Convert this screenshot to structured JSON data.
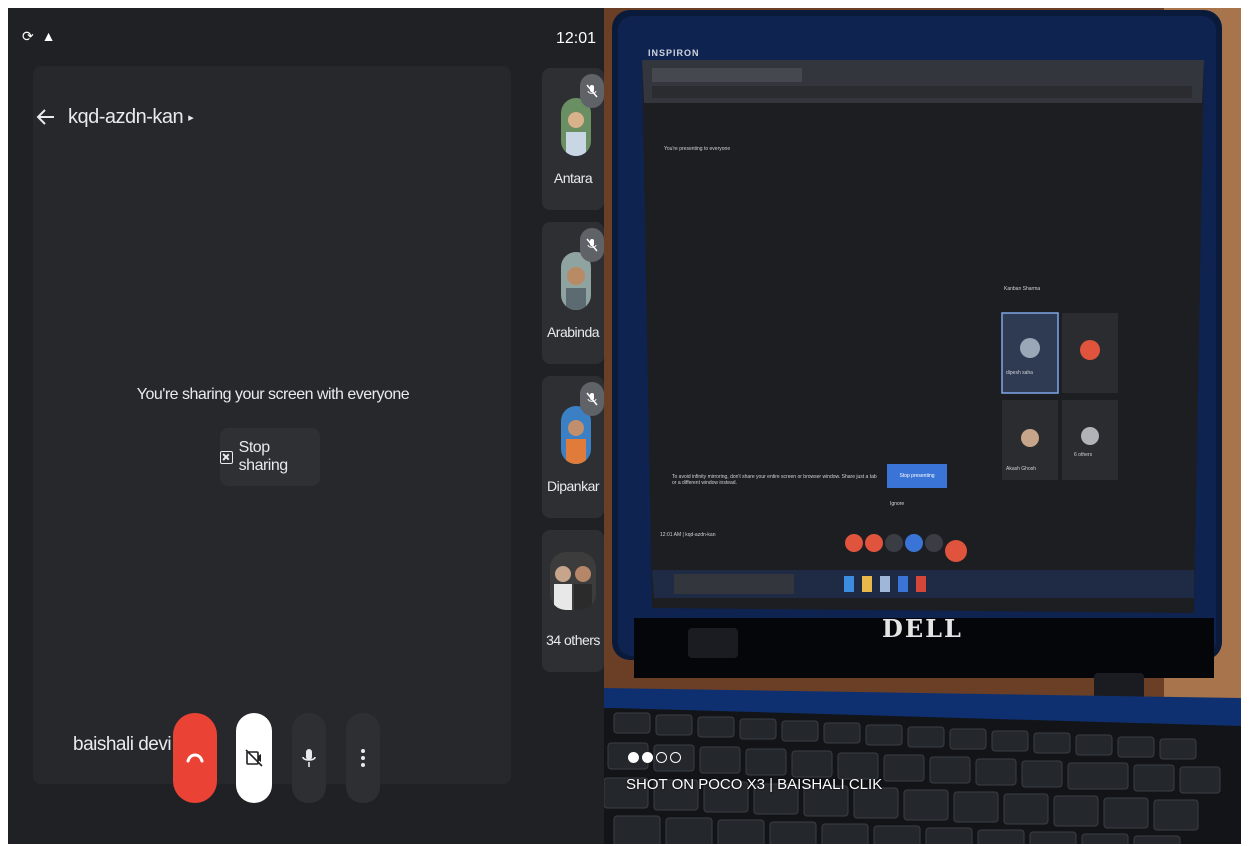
{
  "status_bar": {
    "left_icons": "⟳ ▲",
    "time": "12:01"
  },
  "meeting": {
    "code": "kqd-azdn-kan",
    "code_caret": "▸"
  },
  "sharing": {
    "message": "You're sharing your screen with everyone",
    "stop_label": "Stop sharing"
  },
  "participants": [
    {
      "name": "Antara",
      "muted": true
    },
    {
      "name": "Arabinda",
      "muted": true
    },
    {
      "name": "Dipankar",
      "muted": true
    },
    {
      "name": "34 others",
      "muted": false
    }
  ],
  "self": {
    "name": "baishali devi"
  },
  "controls": {
    "end_call_icon": "call-end-icon",
    "camera_icon": "camera-off-icon",
    "mic_icon": "mic-icon",
    "more_icon": "more-vert-icon"
  },
  "colors": {
    "end_call": "#ea4335",
    "background": "#202124",
    "tile": "#2e2f33"
  },
  "photo": {
    "laptop_brand": "INSPIRON",
    "laptop_logo": "DELL",
    "watermark": "SHOT ON POCO X3 | BAISHALI CLIK",
    "screen": {
      "presenting_note": "You're presenting to everyone",
      "participants": [
        "Kanban Sharma",
        "dipesh saha",
        "Akash Ghosh",
        "6 others"
      ],
      "warning": "To avoid infinity mirroring, don't share your entire screen or browser window. Share just a tab or a different window instead.",
      "stop_presenting": "Stop presenting",
      "ignore": "Ignore",
      "meeting_time": "12:01 AM | kqd-azdn-kan"
    }
  }
}
